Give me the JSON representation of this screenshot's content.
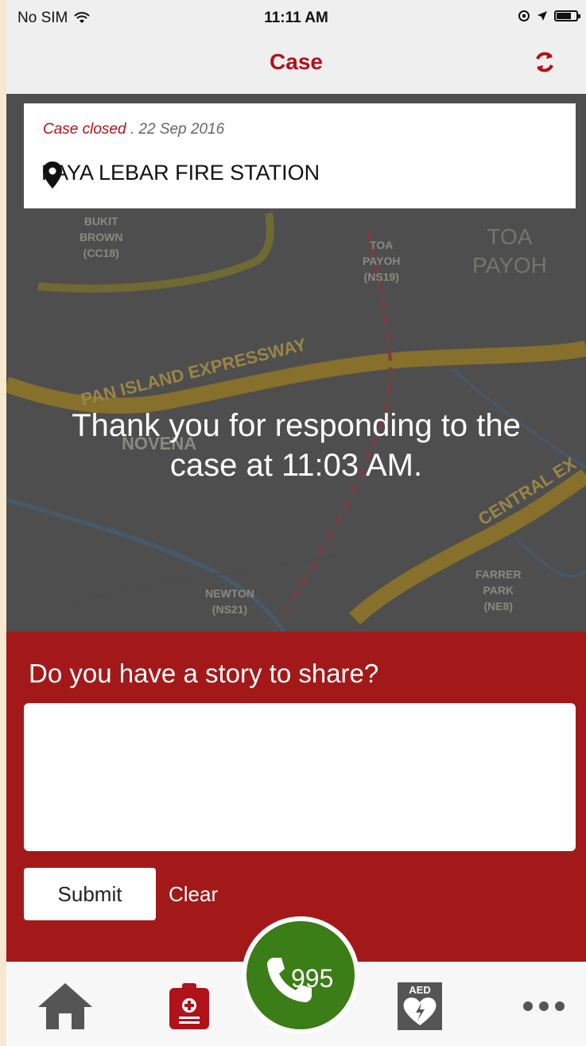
{
  "status_bar": {
    "carrier": "No SIM",
    "time": "11:11 AM"
  },
  "nav": {
    "title": "Case",
    "accent_color": "#b0121a"
  },
  "case": {
    "status_label": "Case closed",
    "date": ". 22 Sep 2016",
    "location": "PAYA LEBAR FIRE STATION"
  },
  "map": {
    "labels": {
      "bukit_brown": "BUKIT\nBROWN\n(CC18)",
      "toa_payoh_station": "TOA\nPAYOH\n(NS19)",
      "toa_payoh": "TOA\nPAYOH",
      "expressway": "PAN ISLAND EXPRESSWAY",
      "novena": "NOVENA",
      "newton": "NEWTON\n(NS21)",
      "farrer_park": "FARRER\nPARK\n(NE8)",
      "central": "CENTRAL EX"
    },
    "overlay_message": "Thank you for responding to the case at 11:03 AM."
  },
  "story": {
    "question": "Do you have a story to share?",
    "input_value": "",
    "input_placeholder": "",
    "submit_label": "Submit",
    "clear_label": "Clear",
    "panel_color": "#a31919"
  },
  "tab_bar": {
    "call_number": "995",
    "aed_label": "AED",
    "call_color": "#3b7d16"
  }
}
